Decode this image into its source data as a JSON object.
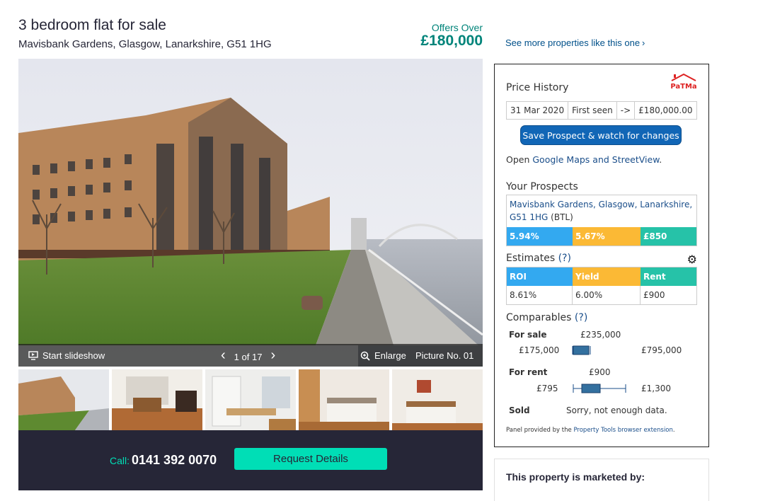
{
  "listing": {
    "title": "3 bedroom flat for sale",
    "address": "Mavisbank Gardens, Glasgow, Lanarkshire, G51 1HG",
    "price_qualifier": "Offers Over",
    "price": "£180,000",
    "see_more": "See more properties like this one"
  },
  "gallery": {
    "slideshow_label": "Start slideshow",
    "counter": "1 of 17",
    "enlarge_label": "Enlarge",
    "picture_no": "Picture No. 01",
    "thumbnails": [
      "exterior",
      "dining room",
      "kitchen",
      "bedroom",
      "bedroom 2"
    ]
  },
  "contact": {
    "call_label": "Call:",
    "phone": "0141 392 0070",
    "request_label": "Request Details"
  },
  "panel": {
    "price_history": {
      "heading": "Price History",
      "logo": "PaTMa",
      "date": "31 Mar 2020",
      "event": "First seen",
      "arrow": "->",
      "amount": "£180,000.00"
    },
    "save_button": "Save Prospect & watch for changes",
    "open_prefix": "Open ",
    "maps_link": "Google Maps and StreetView",
    "open_suffix": ".",
    "prospects": {
      "heading": "Your Prospects",
      "address": "Mavisbank Gardens, Glasgow, Lanarkshire, G51 1HG",
      "tag": "(BTL)",
      "values": [
        "5.94%",
        "5.67%",
        "£850"
      ]
    },
    "estimates": {
      "heading": "Estimates",
      "help": "(?)",
      "headers": [
        "ROI",
        "Yield",
        "Rent"
      ],
      "values": [
        "8.61%",
        "6.00%",
        "£900"
      ]
    },
    "comparables": {
      "heading": "Comparables",
      "help": "(?)",
      "for_sale": {
        "label": "For sale",
        "median": "£235,000",
        "min": "£175,000",
        "max": "£795,000"
      },
      "for_rent": {
        "label": "For rent",
        "median": "£900",
        "min": "£795",
        "max": "£1,300"
      },
      "sold": {
        "label": "Sold",
        "message": "Sorry, not enough data."
      }
    },
    "footnote_prefix": "Panel provided by the ",
    "footnote_link": "Property Tools browser extension",
    "footnote_suffix": "."
  },
  "agent": {
    "heading": "This property is marketed by:"
  },
  "colors": {
    "brand_green": "#00847a",
    "cta_dark": "#262637",
    "cta_accent": "#00deb6",
    "roi_blue": "#33a9f0",
    "yield_orange": "#fbb935",
    "rent_teal": "#26c2a8"
  }
}
